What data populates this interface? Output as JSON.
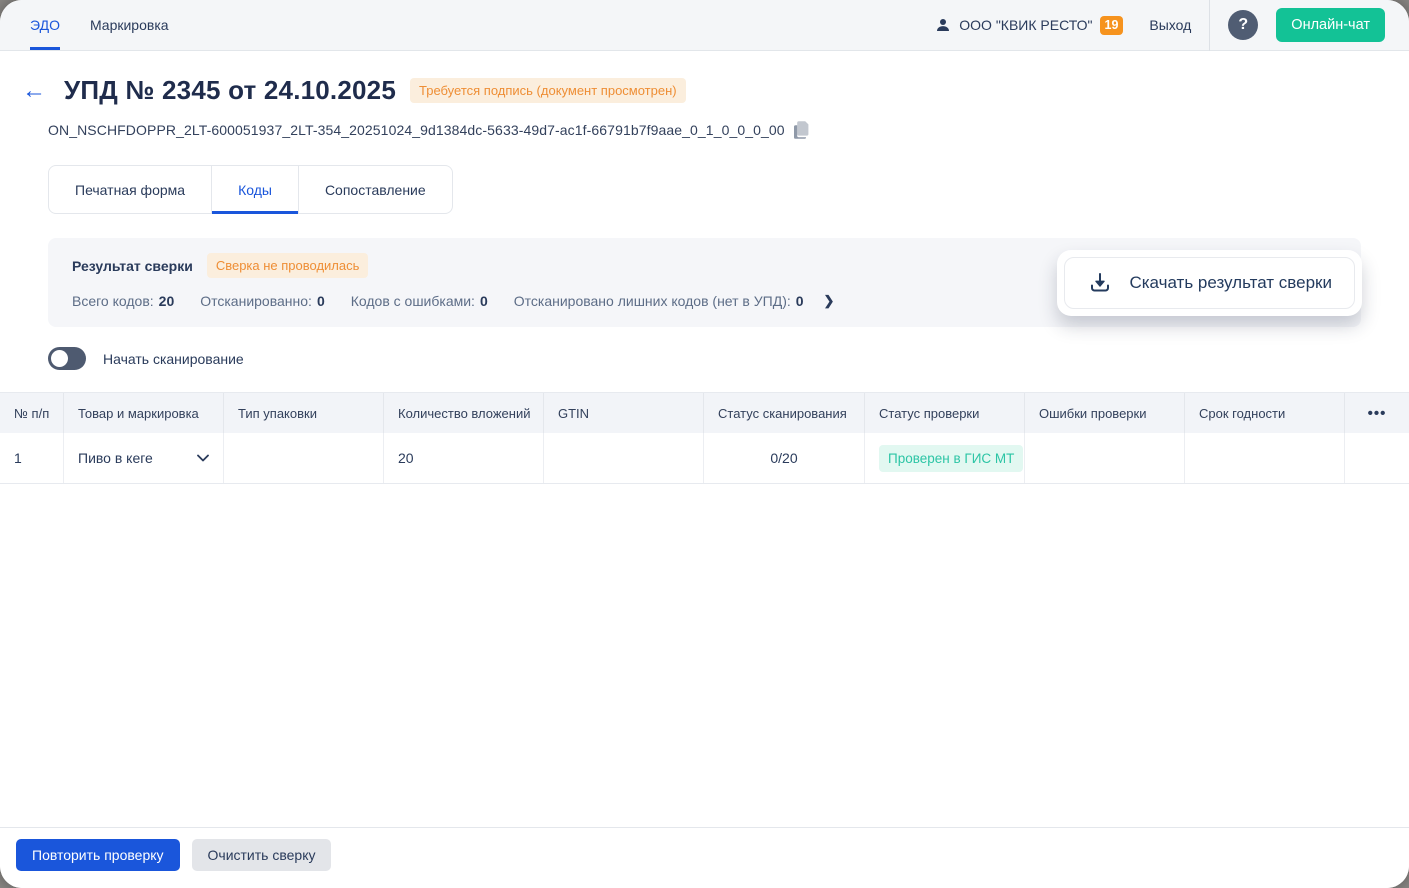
{
  "topbar": {
    "nav": [
      {
        "label": "ЭДО",
        "active": true
      },
      {
        "label": "Маркировка",
        "active": false
      }
    ],
    "company": "ООО \"КВИК РЕСТО\"",
    "badge_count": "19",
    "logout_label": "Выход",
    "help_label": "?",
    "chat_button_label": "Онлайн-чат"
  },
  "header": {
    "title": "УПД № 2345 от 24.10.2025",
    "status_badge": "Требуется подпись (документ просмотрен)",
    "filename": "ON_NSCHFDOPPR_2LT-600051937_2LT-354_20251024_9d1384dc-5633-49d7-ac1f-66791b7f9aae_0_1_0_0_0_00"
  },
  "tabs": [
    {
      "label": "Печатная форма",
      "active": false
    },
    {
      "label": "Коды",
      "active": true
    },
    {
      "label": "Сопоставление",
      "active": false
    }
  ],
  "reconciliation": {
    "title": "Результат сверки",
    "status_badge": "Сверка не проводилась",
    "stats": [
      {
        "label": "Всего кодов:",
        "value": "20"
      },
      {
        "label": "Отсканированно:",
        "value": "0"
      },
      {
        "label": "Кодов с ошибками:",
        "value": "0"
      },
      {
        "label": "Отсканировано лишних кодов (нет в УПД):",
        "value": "0"
      }
    ],
    "download_button_label": "Скачать результат сверки"
  },
  "scan_toggle": {
    "label": "Начать сканирование",
    "state": "off"
  },
  "table": {
    "columns": [
      "№ п/п",
      "Товар и маркировка",
      "Тип упаковки",
      "Количество вложений",
      "GTIN",
      "Статус сканирования",
      "Статус проверки",
      "Ошибки проверки",
      "Срок годности",
      "•••"
    ],
    "rows": [
      {
        "num": "1",
        "product": "Пиво в кеге",
        "package_type": "",
        "nested_count": "20",
        "gtin": "",
        "scan_status": "0/20",
        "check_status": "Проверен в ГИС МТ",
        "check_errors": "",
        "expiry": ""
      }
    ]
  },
  "footer": {
    "repeat_button_label": "Повторить проверку",
    "clear_button_label": "Очистить сверку"
  },
  "colors": {
    "accent_blue": "#1a56db",
    "dark_navy": "#2a3b5b",
    "orange_badge_text": "#ee8e35",
    "orange_badge_bg": "#fbeedd",
    "count_badge_bg": "#f6931e",
    "chat_green": "#13c296",
    "teal_badge_text": "#2cc5a5",
    "teal_badge_bg": "#e2f8f1",
    "panel_bg": "#f5f6f9",
    "table_header_bg": "#f2f4f8"
  }
}
